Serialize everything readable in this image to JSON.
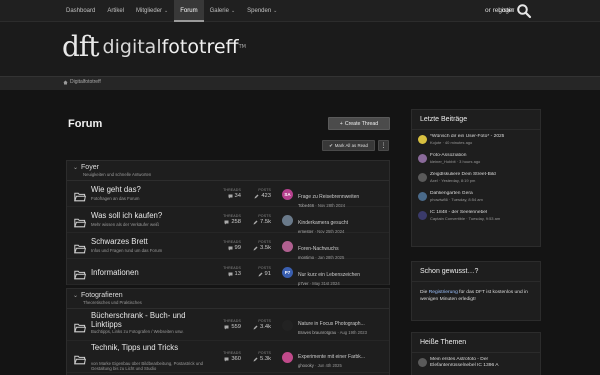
{
  "nav": {
    "items": [
      {
        "label": "Dashboard",
        "active": false,
        "caret": false
      },
      {
        "label": "Artikel",
        "active": false,
        "caret": false
      },
      {
        "label": "Mitglieder",
        "active": false,
        "caret": true
      },
      {
        "label": "Forum",
        "active": true,
        "caret": false
      },
      {
        "label": "Galerie",
        "active": false,
        "caret": true
      },
      {
        "label": "Spenden",
        "active": false,
        "caret": true
      }
    ],
    "login_label": "Login",
    "register_label": "or register"
  },
  "logo": {
    "mark": "dft",
    "text_a": "digital",
    "text_b": "fototreff",
    "tm": "TM"
  },
  "breadcrumb": {
    "home": "Digitalfototreff"
  },
  "main": {
    "title": "Forum",
    "create_thread": "Create Thread",
    "mark_all_read": "Mark All as Read"
  },
  "categories": [
    {
      "title": "Foyer",
      "description": "Neuigkeiten und schnelle Antworten",
      "nodes": [
        {
          "title": "Wie geht das?",
          "description": "Fotofragen an das Forum",
          "threads": "34",
          "posts": "423",
          "avatar_text": "SA",
          "avatar_color": "#b5408d",
          "last_title": "Frage zu Reisebrennweiten",
          "last_user": "Tobe466",
          "last_date": "Nov 28th 2024"
        },
        {
          "title": "Was soll ich kaufen?",
          "description": "Mehr wissen als der Verkäufer weiß",
          "threads": "258",
          "posts": "7.5k",
          "avatar_text": "",
          "avatar_color": "#6a7a8a",
          "last_title": "Kinderkamera gesucht",
          "last_user": "ernester",
          "last_date": "Nov 25th 2024"
        },
        {
          "title": "Schwarzes Brett",
          "description": "Infos und Fragen rund um das Forum",
          "threads": "99",
          "posts": "3.5k",
          "avatar_text": "",
          "avatar_color": "#b06090",
          "last_title": "Foren-Nachwuchs",
          "last_user": "montimo",
          "last_date": "Jan 28th 2025"
        },
        {
          "title": "Informationen",
          "description": "",
          "threads": "13",
          "posts": "91",
          "avatar_text": "P7",
          "avatar_color": "#3a5fb0",
          "last_title": "Nur kurz ein Lebenszeichen",
          "last_user": "p7ver",
          "last_date": "May 31st 2024"
        }
      ]
    },
    {
      "title": "Fotografieren",
      "description": "Theoretisches und Praktisches",
      "nodes": [
        {
          "title": "Bücherschrank - Buch- und Linktipps",
          "description": "Buchtipps, Links zu Fotografen / Webseiten usw.",
          "threads": "559",
          "posts": "3.4k",
          "avatar_text": "",
          "avatar_color": "#222",
          "last_title": "Nature in Focus Photograph...",
          "last_user": "Braves braunrotgrau",
          "last_date": "Aug 19th 2023"
        },
        {
          "title": "Technik, Tipps und Tricks",
          "description": "von Marke Eigenbau über Bildbearbeitung, Postastrick und Gestaltung bis zu Licht und Studio",
          "threads": "360",
          "posts": "5.3k",
          "avatar_text": "",
          "avatar_color": "#c04a8a",
          "last_title": "Experimente mit einer Farbk...",
          "last_user": "ghoooky",
          "last_date": "Jun 4th 2025"
        }
      ]
    }
  ],
  "stats_labels": {
    "threads": "THREADS",
    "posts": "POSTS"
  },
  "sidebar": {
    "latest": {
      "title": "Letzte Beiträge",
      "items": [
        {
          "title": "*Wünsch dir ein User-Foto* - 2025",
          "user": "Kojote",
          "time": "40 minutes ago",
          "color": "#d8c040"
        },
        {
          "title": "Foto-Assoziation",
          "user": "kleiner_Hobbit",
          "time": "3 hours ago",
          "color": "#8a6a9a"
        },
        {
          "title": "Zeigdlskuliere Dein Street-Bild",
          "user": "Axel",
          "time": "Yesterday, 8:19 pm",
          "color": "#5a5a5a"
        },
        {
          "title": "Dahliengarten Gera",
          "user": "phowiw86",
          "time": "Tuesday, 8:54 am",
          "color": "#4a6a8a"
        },
        {
          "title": "IC 1848 - der Seelennebel",
          "user": "Captain Convertible",
          "time": "Tuesday, 9:53 am",
          "color": "#3a3a6a"
        }
      ]
    },
    "knew": {
      "title": "Schon gewusst…?",
      "text_a": "Die ",
      "link": "Registrierung",
      "text_b": " für das DFT ist kostenlos und in wenigen Minuten erledigt!"
    },
    "hot": {
      "title": "Heiße Themen",
      "item_title": "Mein erstes Astrofoto - Der Elefantenrüsselnebel IC 1396 A",
      "color": "#5a5a5a"
    }
  },
  "colors": {
    "accent": "#9ec3ff",
    "background": "#141414",
    "panel": "#1e1e1e"
  }
}
